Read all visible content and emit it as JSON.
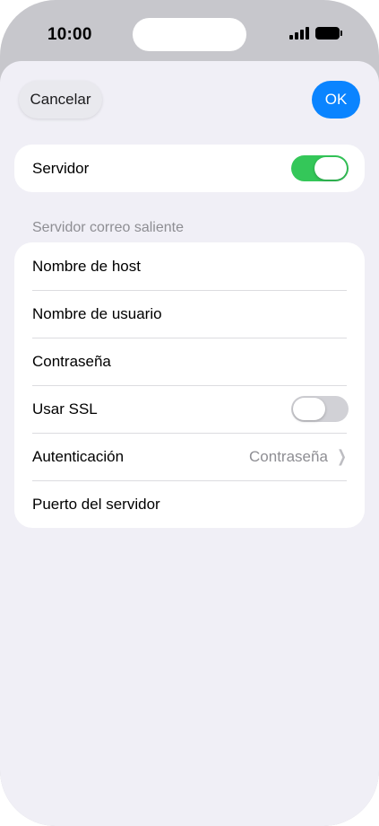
{
  "status": {
    "time": "10:00"
  },
  "nav": {
    "cancel_label": "Cancelar",
    "ok_label": "OK"
  },
  "server_group": {
    "label": "Servidor",
    "enabled": true
  },
  "outgoing": {
    "header": "Servidor correo saliente",
    "rows": [
      {
        "label": "Nombre de host"
      },
      {
        "label": "Nombre de usuario"
      },
      {
        "label": "Contraseña"
      },
      {
        "label": "Usar SSL",
        "enabled": false
      },
      {
        "label": "Autenticación",
        "value": "Contraseña"
      },
      {
        "label": "Puerto del servidor"
      }
    ]
  },
  "colors": {
    "accent": "#0a84ff",
    "toggle_on": "#34c759",
    "toggle_off": "#d1d1d6",
    "background": "#f0eff6"
  }
}
